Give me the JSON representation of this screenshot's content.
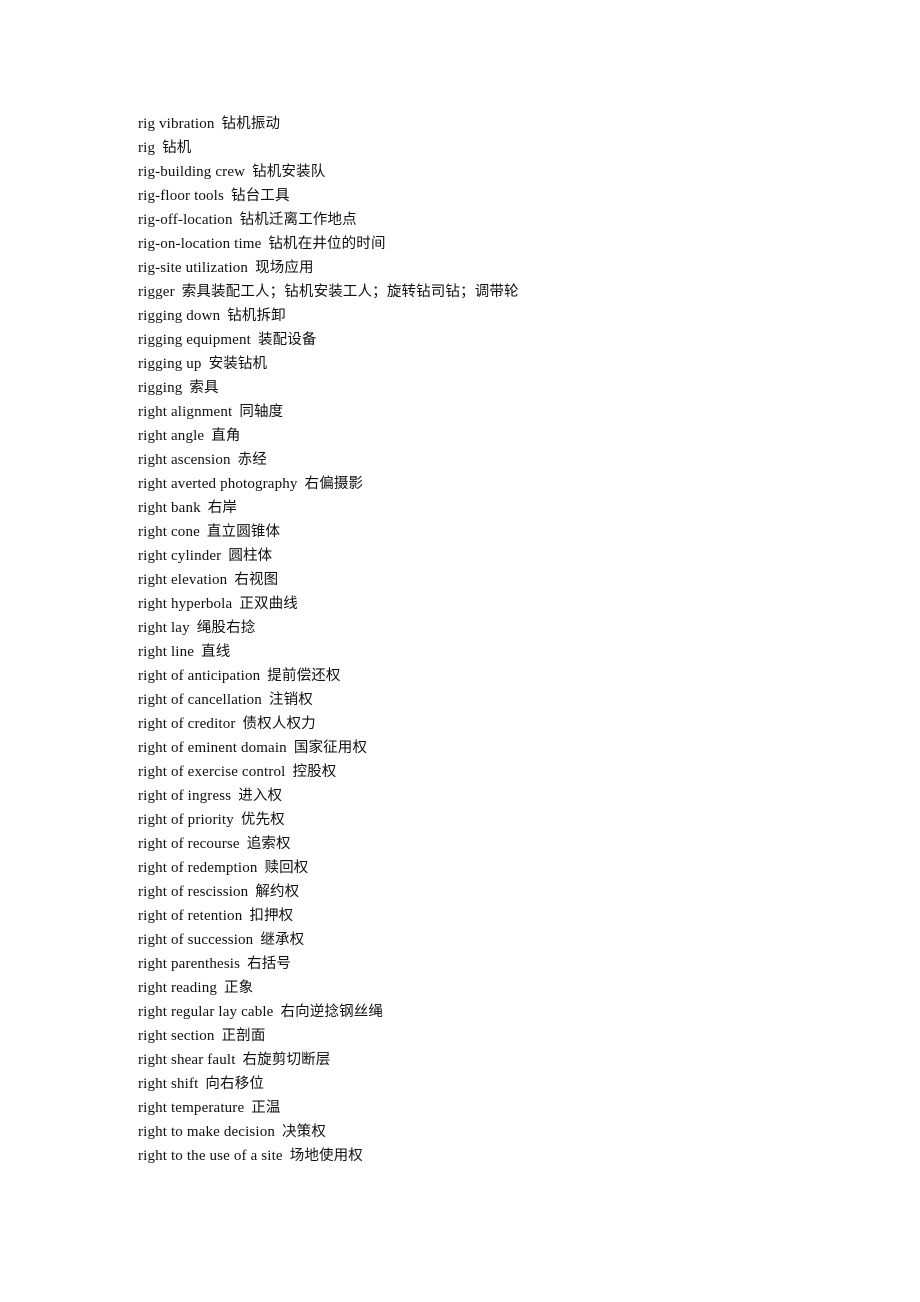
{
  "page": {
    "background_color": "#ffffff",
    "text_color": "#111111",
    "kind": "bilingual-glossary-page"
  },
  "glossary": {
    "entries": [
      {
        "term": "rig vibration",
        "gloss": "钻机振动"
      },
      {
        "term": "rig",
        "gloss": "钻机"
      },
      {
        "term": "rig-building crew",
        "gloss": "钻机安装队"
      },
      {
        "term": "rig-floor tools",
        "gloss": "钻台工具"
      },
      {
        "term": "rig-off-location",
        "gloss": "钻机迁离工作地点"
      },
      {
        "term": "rig-on-location time",
        "gloss": "钻机在井位的时间"
      },
      {
        "term": "rig-site utilization",
        "gloss": "现场应用"
      },
      {
        "term": "rigger",
        "gloss": "索具装配工人；钻机安装工人；旋转钻司钻；调带轮"
      },
      {
        "term": "rigging down",
        "gloss": "钻机拆卸"
      },
      {
        "term": "rigging equipment",
        "gloss": "装配设备"
      },
      {
        "term": "rigging up",
        "gloss": "安装钻机"
      },
      {
        "term": "rigging",
        "gloss": "索具"
      },
      {
        "term": "right alignment",
        "gloss": "同轴度"
      },
      {
        "term": "right angle",
        "gloss": "直角"
      },
      {
        "term": "right ascension",
        "gloss": "赤经"
      },
      {
        "term": "right averted photography",
        "gloss": "右偏摄影"
      },
      {
        "term": "right bank",
        "gloss": "右岸"
      },
      {
        "term": "right cone",
        "gloss": "直立圆锥体"
      },
      {
        "term": "right cylinder",
        "gloss": "圆柱体"
      },
      {
        "term": "right elevation",
        "gloss": "右视图"
      },
      {
        "term": "right hyperbola",
        "gloss": "正双曲线"
      },
      {
        "term": "right lay",
        "gloss": "绳股右捻"
      },
      {
        "term": "right line",
        "gloss": "直线"
      },
      {
        "term": "right of anticipation",
        "gloss": "提前偿还权"
      },
      {
        "term": "right of cancellation",
        "gloss": "注销权"
      },
      {
        "term": "right of creditor",
        "gloss": "债权人权力"
      },
      {
        "term": "right of eminent domain",
        "gloss": "国家征用权"
      },
      {
        "term": "right of exercise control",
        "gloss": "控股权"
      },
      {
        "term": "right of ingress",
        "gloss": "进入权"
      },
      {
        "term": "right of priority",
        "gloss": "优先权"
      },
      {
        "term": "right of recourse",
        "gloss": "追索权"
      },
      {
        "term": "right of redemption",
        "gloss": "赎回权"
      },
      {
        "term": "right of rescission",
        "gloss": "解约权"
      },
      {
        "term": "right of retention",
        "gloss": "扣押权"
      },
      {
        "term": "right of succession",
        "gloss": "继承权"
      },
      {
        "term": "right parenthesis",
        "gloss": "右括号"
      },
      {
        "term": "right reading",
        "gloss": "正象"
      },
      {
        "term": "right regular lay cable",
        "gloss": "右向逆捻钢丝绳"
      },
      {
        "term": "right section",
        "gloss": "正剖面"
      },
      {
        "term": "right shear fault",
        "gloss": "右旋剪切断层"
      },
      {
        "term": "right shift",
        "gloss": "向右移位"
      },
      {
        "term": "right temperature",
        "gloss": "正温"
      },
      {
        "term": "right to make decision",
        "gloss": "决策权"
      },
      {
        "term": "right to the use of a site",
        "gloss": "场地使用权"
      }
    ]
  }
}
